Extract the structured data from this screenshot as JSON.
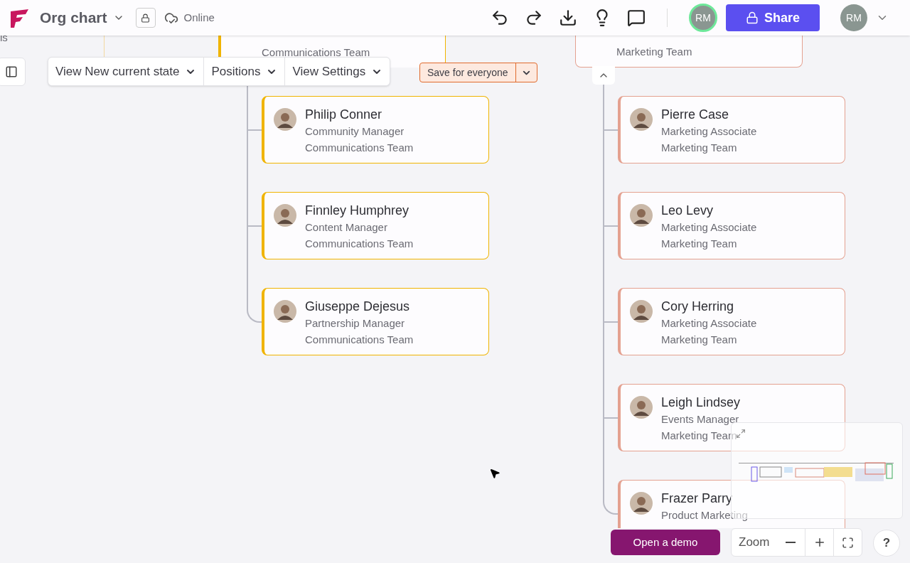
{
  "header": {
    "title": "Org chart",
    "status": "Online",
    "share": "Share",
    "collaborator": "RM",
    "user": "RM"
  },
  "toolbar": {
    "views": [
      "View New current state",
      "Positions",
      "View Settings"
    ],
    "save": "Save for everyone"
  },
  "canvas": {
    "fragment": "is",
    "columns": [
      {
        "color": "#f0b400",
        "top_card": {
          "lines": [
            "Communications Team"
          ]
        },
        "cards": [
          {
            "name": "Philip Conner",
            "role": "Community Manager",
            "team": "Communications Team"
          },
          {
            "name": "Finnley Humphrey",
            "role": "Content Manager",
            "team": "Communications Team"
          },
          {
            "name": "Giuseppe Dejesus",
            "role": "Partnership Manager",
            "team": "Communications Team"
          }
        ]
      },
      {
        "color": "#e4a190",
        "top_card": {
          "lines": [
            "Marketing Team"
          ]
        },
        "cards": [
          {
            "name": "Pierre Case",
            "role": "Marketing Associate",
            "team": "Marketing Team"
          },
          {
            "name": "Leo Levy",
            "role": "Marketing Associate",
            "team": "Marketing Team"
          },
          {
            "name": "Cory Herring",
            "role": "Marketing Associate",
            "team": "Marketing Team"
          },
          {
            "name": "Leigh Lindsey",
            "role": "Events Manager",
            "team": "Marketing Team"
          },
          {
            "name": "Frazer Parry",
            "role": "Product Marketing"
          }
        ]
      }
    ]
  },
  "bottom": {
    "demo": "Open a demo",
    "zoom": "Zoom",
    "help": "?"
  }
}
